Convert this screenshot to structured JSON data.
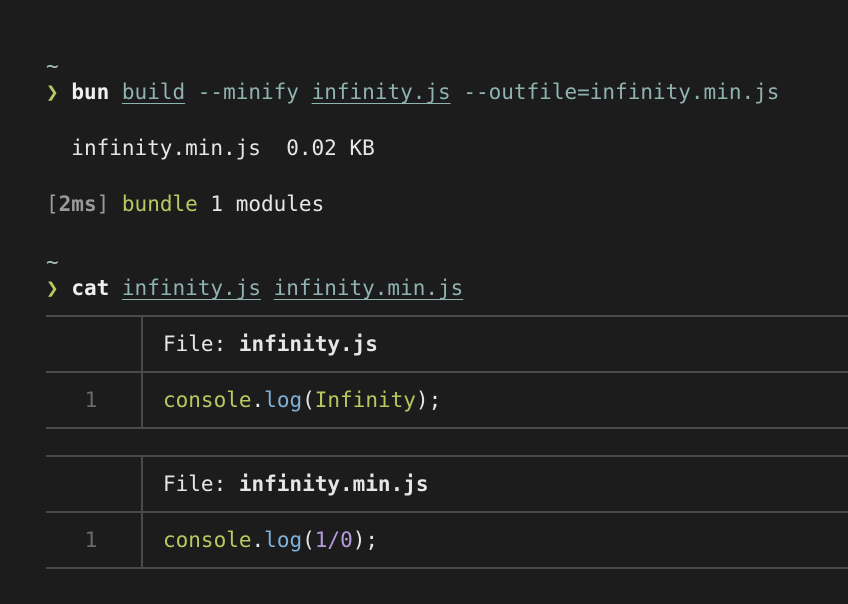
{
  "block1": {
    "tilde": "~",
    "prompt_symbol": "❯",
    "command": "bun",
    "args": {
      "sub": "build",
      "flag1": "--minify",
      "file": "infinity.js",
      "flag2": "--outfile=infinity.min.js"
    }
  },
  "output": {
    "file_line": "infinity.min.js  0.02 KB",
    "bundle": {
      "open_bracket": "[",
      "time": "2ms",
      "close_bracket": "]",
      "word": "bundle",
      "rest": "1 modules"
    }
  },
  "block2": {
    "tilde": "~",
    "prompt_symbol": "❯",
    "command": "cat",
    "file1": "infinity.js",
    "file2": "infinity.min.js"
  },
  "file_views": [
    {
      "header_label": "File: ",
      "filename": "infinity.js",
      "line_number": "1",
      "code": {
        "obj": "console",
        "dot": ".",
        "fn": "log",
        "open": "(",
        "arg": "Infinity",
        "close": ");"
      }
    },
    {
      "header_label": "File: ",
      "filename": "infinity.min.js",
      "line_number": "1",
      "code": {
        "obj": "console",
        "dot": ".",
        "fn": "log",
        "open": "(",
        "num1": "1",
        "op": "/",
        "num2": "0",
        "close": ");"
      }
    }
  ],
  "colors": {
    "background": "#1c1c1c",
    "prompt": "#b9c95f",
    "link": "#8fb3b0",
    "number": "#b79be0",
    "function": "#7fb0d8"
  }
}
